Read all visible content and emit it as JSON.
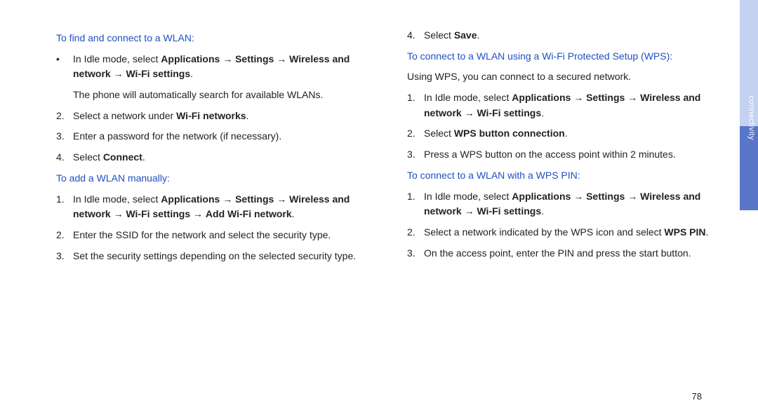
{
  "pageNumber": "78",
  "sideTab": "connectivity",
  "leftCol": {
    "sec1": {
      "heading": "To find and connect to a WLAN:",
      "item1_pre": "In Idle mode, select ",
      "item1_b1": "Applications",
      "item1_arr1": " → ",
      "item1_b2": "Settings",
      "item1_arr2": " → ",
      "item1_b3": "Wireless and network",
      "item1_arr3": " → ",
      "item1_b4": "Wi-Fi settings",
      "item1_post": ".",
      "item1_sub": "The phone will automatically search for available WLANs.",
      "item2_pre": "Select a network under ",
      "item2_b": "Wi-Fi networks",
      "item2_post": ".",
      "item3": "Enter a password for the network (if necessary).",
      "item4_pre": "Select ",
      "item4_b": "Connect",
      "item4_post": "."
    },
    "sec2": {
      "heading": "To add a WLAN manually:",
      "item1_pre": "In Idle mode, select ",
      "item1_b1": "Applications",
      "item1_arr1": " → ",
      "item1_b2": "Settings",
      "item1_arr2": " → ",
      "item1_b3": "Wireless and network",
      "item1_arr3": " → ",
      "item1_b4": "Wi-Fi settings",
      "item1_arr4": " → ",
      "item1_b5": "Add Wi-Fi network",
      "item1_post": ".",
      "item2": "Enter the SSID for the network and select the security type.",
      "item3": "Set the security settings depending on the selected security type."
    }
  },
  "rightCol": {
    "contItem4_pre": "Select ",
    "contItem4_b": "Save",
    "contItem4_post": ".",
    "sec3": {
      "heading": "To connect to a WLAN using a Wi-Fi Protected Setup (WPS):",
      "intro": "Using WPS, you can connect to a secured network.",
      "item1_pre": "In Idle mode, select ",
      "item1_b1": "Applications",
      "item1_arr1": " → ",
      "item1_b2": "Settings",
      "item1_arr2": " → ",
      "item1_b3": "Wireless and network",
      "item1_arr3": " → ",
      "item1_b4": "Wi-Fi settings",
      "item1_post": ".",
      "item2_pre": "Select ",
      "item2_b": "WPS button connection",
      "item2_post": ".",
      "item3": "Press a WPS button on the access point within 2 minutes."
    },
    "sec4": {
      "heading": "To connect to a WLAN with a WPS PIN:",
      "item1_pre": "In Idle mode, select ",
      "item1_b1": "Applications",
      "item1_arr1": " → ",
      "item1_b2": "Settings",
      "item1_arr2": " → ",
      "item1_b3": "Wireless and network",
      "item1_arr3": " → ",
      "item1_b4": "Wi-Fi settings",
      "item1_post": ".",
      "item2_pre": "Select a network indicated by the WPS icon and select ",
      "item2_b": "WPS PIN",
      "item2_post": ".",
      "item3": "On the access point, enter the PIN and press the start button."
    }
  }
}
